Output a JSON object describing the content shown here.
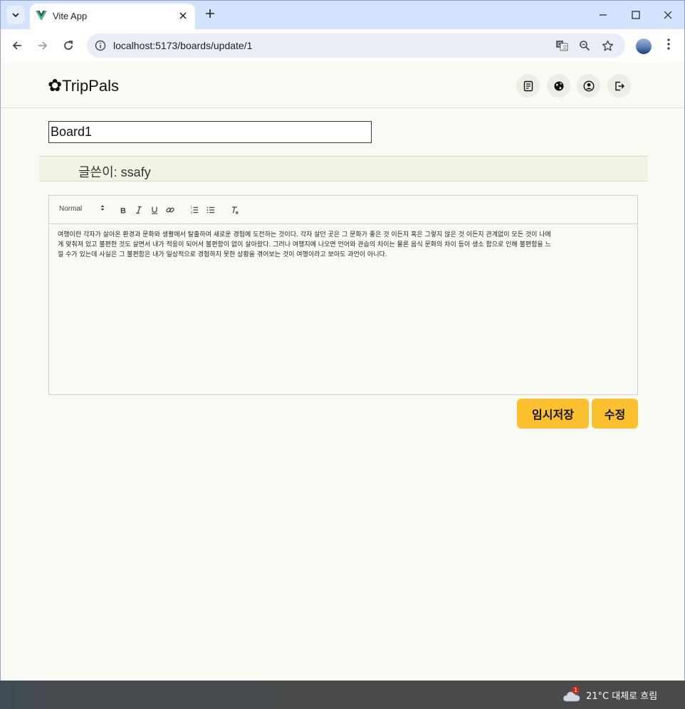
{
  "browser": {
    "tab_title": "Vite App",
    "url": "localhost:5173/boards/update/1",
    "icons": {
      "tab_list": "chevron-down-icon",
      "close_tab": "close-icon",
      "new_tab": "plus-icon",
      "minimize": "minimize-icon",
      "maximize": "maximize-icon",
      "close_window": "close-icon",
      "back": "arrow-left-icon",
      "forward": "arrow-right-icon",
      "reload": "reload-icon",
      "site_info": "site-info-icon",
      "translate": "translate-icon",
      "zoom": "zoom-icon",
      "bookmark": "star-icon",
      "profile": "avatar",
      "menu": "more-vertical-icon"
    }
  },
  "app": {
    "brand_icon": "✿",
    "brand_name": "TripPals",
    "header_buttons": [
      "board-icon",
      "globe-icon",
      "user-icon",
      "logout-icon"
    ]
  },
  "form": {
    "title_value": "Board1",
    "author_label": "글쓴이: ssafy",
    "editor": {
      "format_select": "Normal",
      "toolbar_icons": [
        "bold-icon",
        "italic-icon",
        "underline-icon",
        "link-icon",
        "ordered-list-icon",
        "bullet-list-icon",
        "clear-format-icon"
      ],
      "content_lines": [
        "여행이란 각자가 살아온 환경과 문화와 생활에서 탈출하여 새로운 경험에 도전하는 것이다. 각자 살던 곳은 그 문화가 좋은 것 이든지 혹은 그렇지 않은 것 이든지 관계없이 모든 것이 나에",
        "게 맞춰져 있고 불편한 것도 살면서 내가 적응이 되어서 불편함이 없이 살아왔다. 그러나 여행지에 나오면 언어와 관습의 차이는 물론 음식 문화의 차이 등이 생소 함으로 인해 불편함을 느",
        "낄 수가 있는데 사실은 그 불편함은 내가 일상적으로 경험하지 못한 상황을 겪어보는 것이  여행이라고 보아도 과언이 아니다."
      ]
    },
    "buttons": {
      "temp_save": "임시저장",
      "update": "수정"
    }
  },
  "taskbar": {
    "weather_badge": "1",
    "weather_text": "21°C  대체로 흐림"
  },
  "colors": {
    "accent_button": "#fbc02d",
    "page_background": "#f9faf4",
    "tabstrip": "#d3e3fd"
  }
}
